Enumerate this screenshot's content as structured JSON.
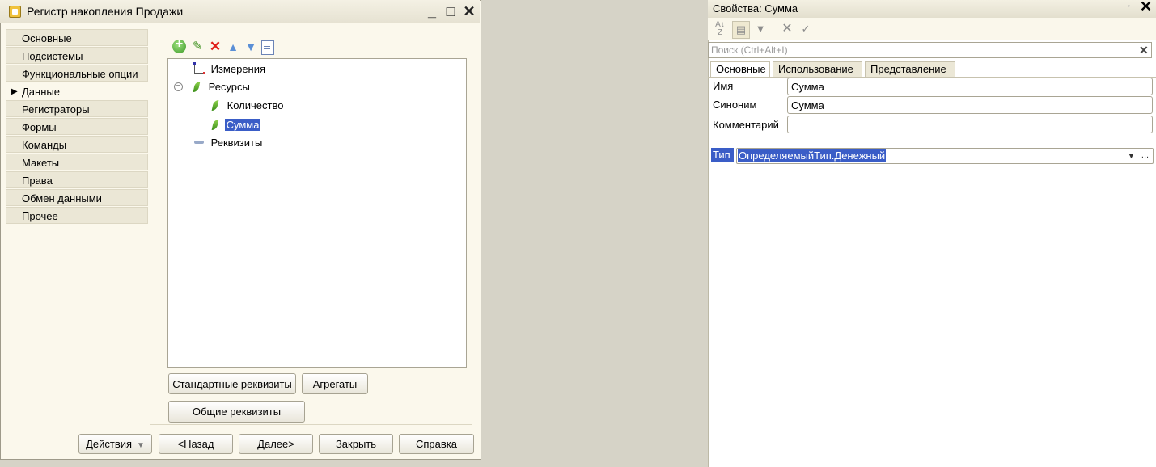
{
  "window": {
    "title": "Регистр накопления Продажи",
    "controls": {
      "minimize": "_",
      "maximize": "□",
      "close": "✕"
    }
  },
  "nav": {
    "items": [
      {
        "label": "Основные",
        "active": false
      },
      {
        "label": "Подсистемы",
        "active": false
      },
      {
        "label": "Функциональные опции",
        "active": false
      },
      {
        "label": "Данные",
        "active": true
      },
      {
        "label": "Регистраторы",
        "active": false
      },
      {
        "label": "Формы",
        "active": false
      },
      {
        "label": "Команды",
        "active": false
      },
      {
        "label": "Макеты",
        "active": false
      },
      {
        "label": "Права",
        "active": false
      },
      {
        "label": "Обмен данными",
        "active": false
      },
      {
        "label": "Прочее",
        "active": false
      }
    ],
    "active_marker": "▶"
  },
  "tree": {
    "dimensions": "Измерения",
    "resources": "Ресурсы",
    "resources_toggle": "−",
    "resource_items": [
      "Количество",
      "Сумма"
    ],
    "selected": "Сумма",
    "attributes": "Реквизиты"
  },
  "buttons": {
    "standard_attributes": "Стандартные реквизиты",
    "aggregates": "Агрегаты",
    "common_attributes": "Общие реквизиты",
    "actions": "Действия",
    "actions_caret": "▼",
    "back": "<Назад",
    "next": "Далее>",
    "close": "Закрыть",
    "help": "Справка"
  },
  "properties": {
    "title": "Свойства: Сумма",
    "pin": "◦",
    "close": "✕",
    "toolbar": {
      "sort": "A↓ Z",
      "cancel": "✕",
      "apply": "✓"
    },
    "search": {
      "placeholder": "Поиск (Ctrl+Alt+I)",
      "value": "",
      "clear": "✕"
    },
    "tabs": [
      "Основные",
      "Использование",
      "Представление"
    ],
    "active_tab": "Основные",
    "fields": {
      "name": {
        "label": "Имя",
        "value": "Сумма"
      },
      "synonym": {
        "label": "Синоним",
        "value": "Сумма"
      },
      "comment": {
        "label": "Комментарий",
        "value": ""
      }
    },
    "type": {
      "label": "Тип",
      "value": "ОпределяемыйТип.Денежный",
      "drop": "▼",
      "more": "..."
    }
  },
  "colors": {
    "selection": "#3a5dc7",
    "background": "#d6d3c7",
    "panel": "#fbf8ec"
  }
}
